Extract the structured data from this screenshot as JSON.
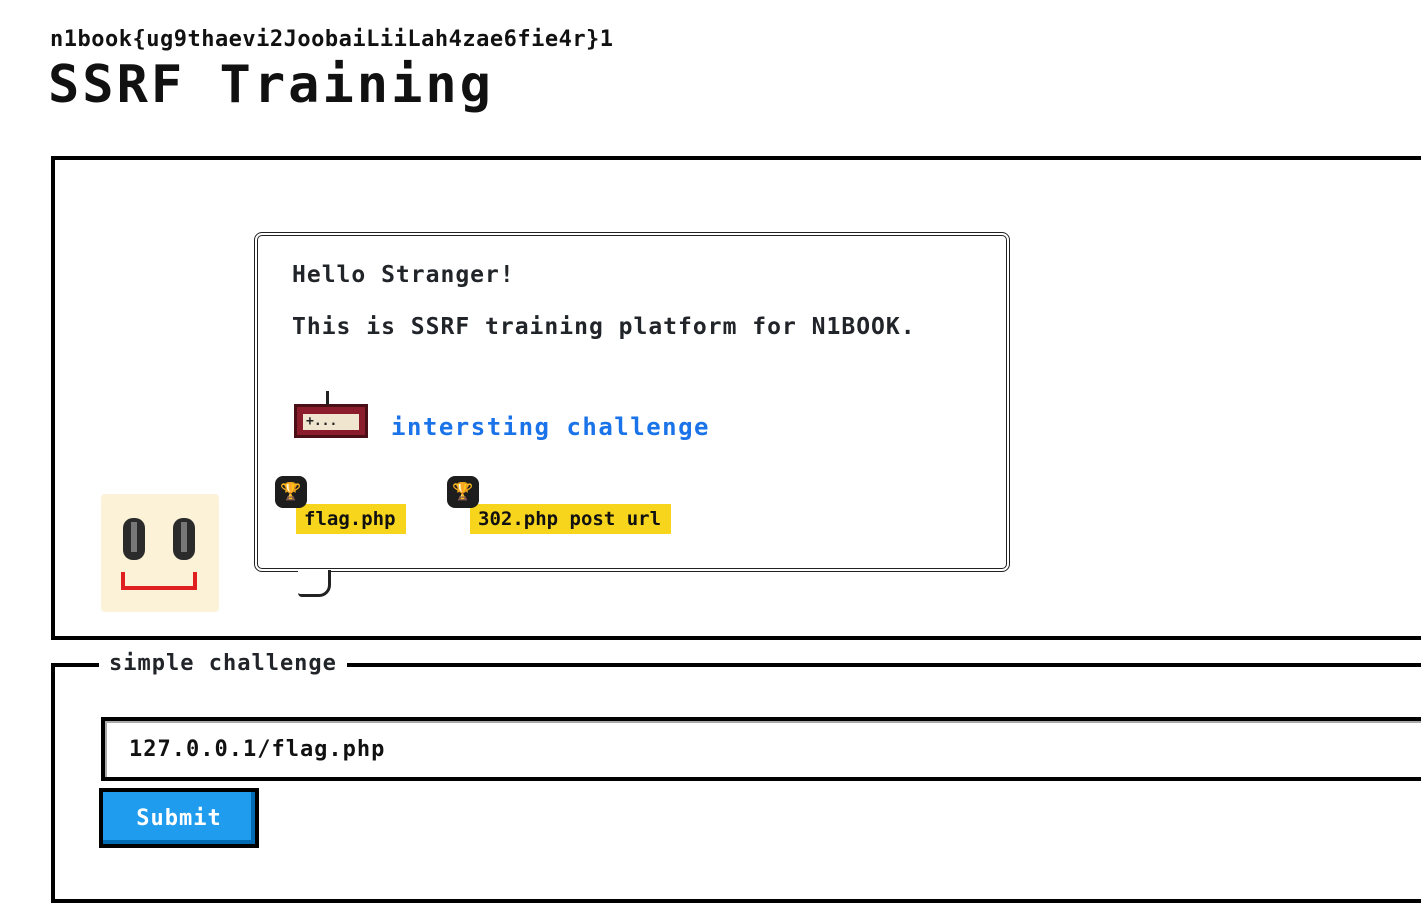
{
  "header": {
    "flag_text": "n1book{ug9thaevi2JoobaiLiiLah4zae6fie4r}1",
    "title": "SSRF Training"
  },
  "bubble": {
    "greeting": "Hello Stranger!",
    "intro": "This is SSRF training platform for N1BOOK.",
    "controller_icon_text": "+...",
    "challenge_link": "intersting challenge",
    "badges": [
      {
        "label": "flag.php",
        "icon": "trophy-icon"
      },
      {
        "label": "302.php post url",
        "icon": "trophy-icon"
      }
    ]
  },
  "form": {
    "legend": "simple challenge",
    "input_value": "127.0.0.1/flag.php",
    "submit_label": "Submit"
  },
  "colors": {
    "link": "#1a73e8",
    "badge": "#f7d51d",
    "button": "#209cee",
    "controller": "#8b1c2c",
    "mouth": "#e02020"
  }
}
